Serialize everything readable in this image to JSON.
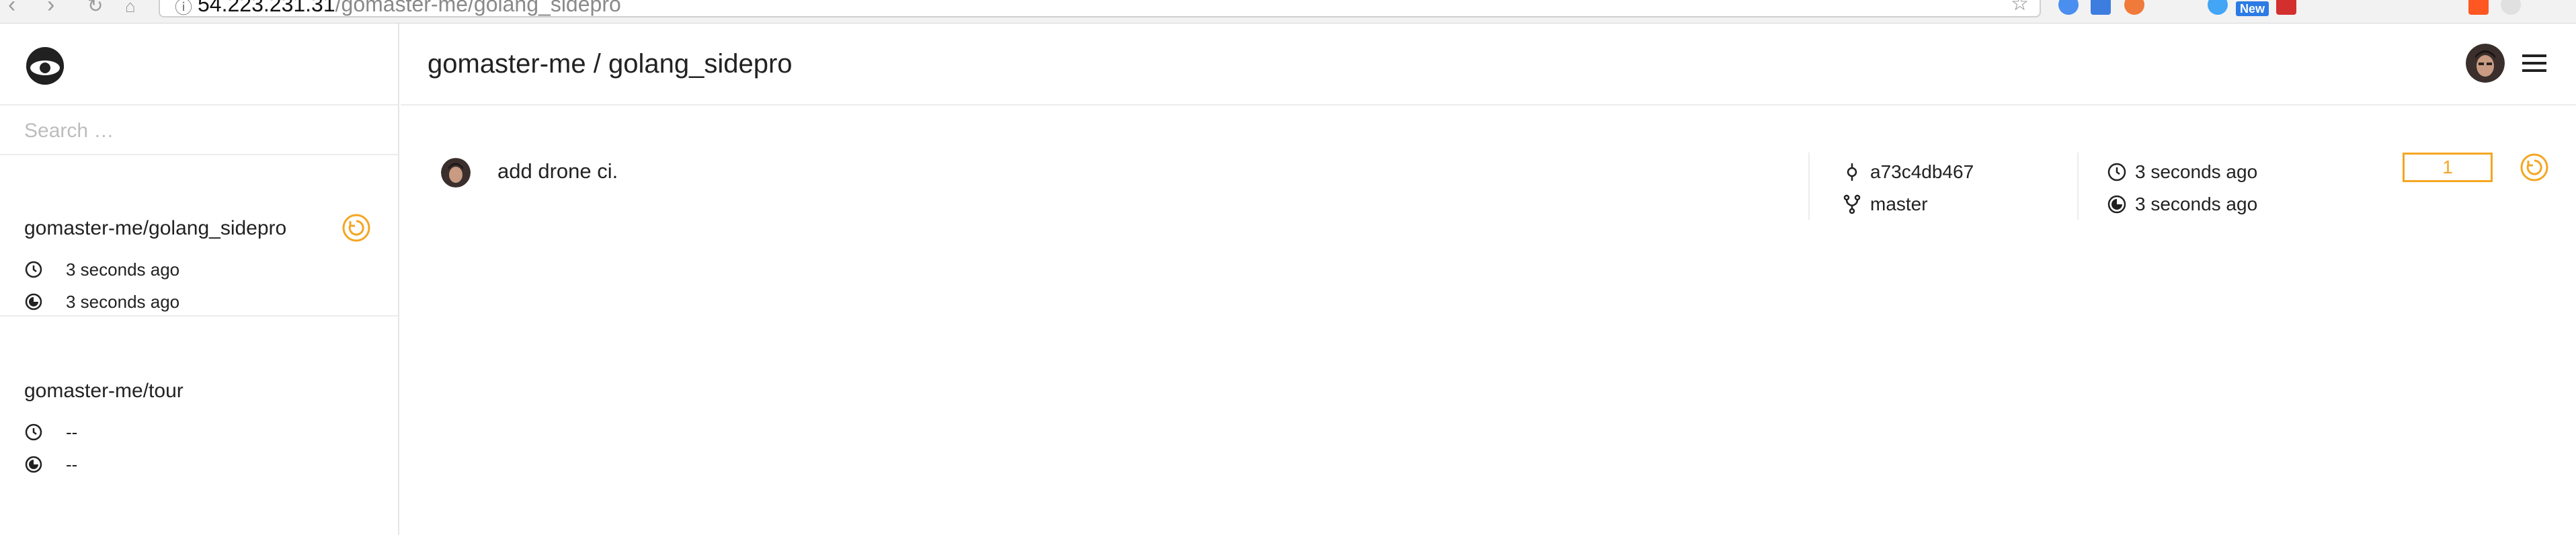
{
  "browser": {
    "url_host": "54.223.231.31",
    "url_path": "/gomaster-me/golang_sidepro",
    "ext_badge": "New"
  },
  "sidebar": {
    "search_placeholder": "Search …",
    "repos": [
      {
        "name": "gomaster-me/golang_sidepro",
        "started": "3 seconds ago",
        "duration": "3 seconds ago",
        "status": "pending"
      },
      {
        "name": "gomaster-me/tour",
        "started": "--",
        "duration": "--"
      }
    ]
  },
  "header": {
    "title": "gomaster-me / golang_sidepro"
  },
  "build": {
    "message": "add drone ci.",
    "commit": "a73c4db467",
    "branch": "master",
    "started": "3 seconds ago",
    "duration": "3 seconds ago",
    "number": "1",
    "status": "pending"
  },
  "colors": {
    "accent_pending": "#f5a623",
    "text": "#212121",
    "divider": "#ececec"
  }
}
